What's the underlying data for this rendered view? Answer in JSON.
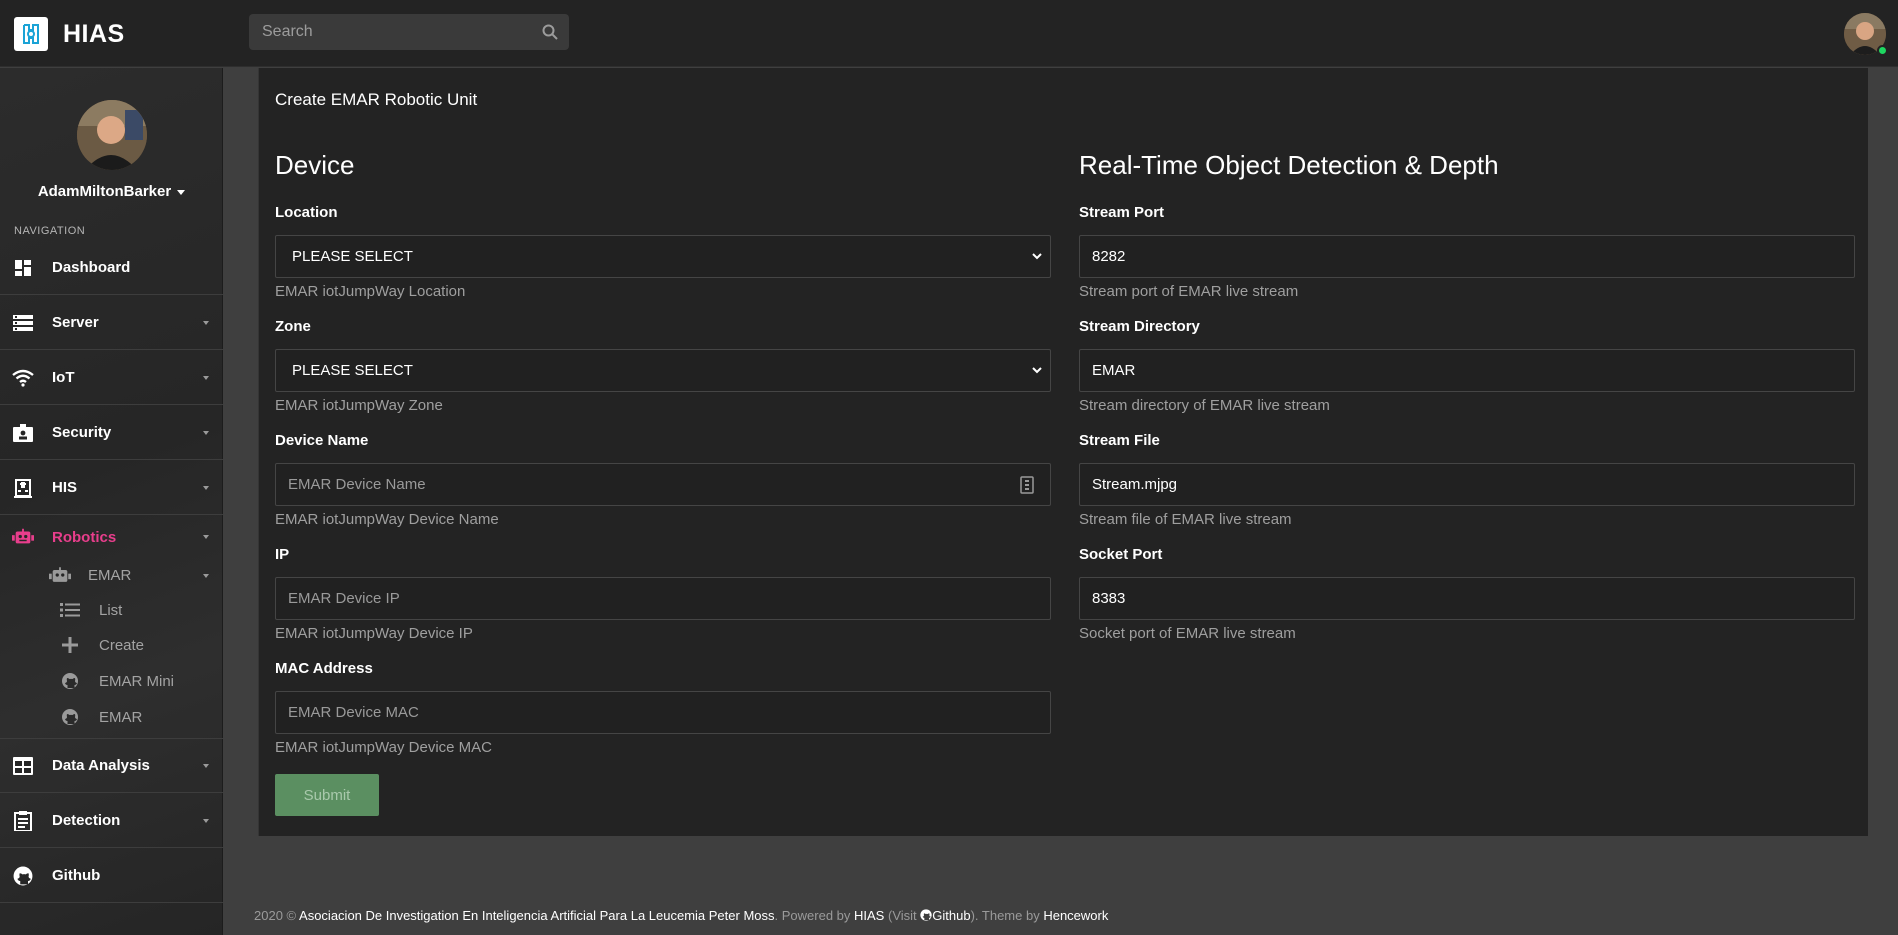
{
  "brand": {
    "name": "HIAS"
  },
  "search": {
    "placeholder": "Search"
  },
  "sidebar": {
    "username": "AdamMiltonBarker",
    "nav_heading": "NAVIGATION",
    "items": [
      {
        "label": "Dashboard",
        "icon": "dashboard-icon"
      },
      {
        "label": "Server",
        "icon": "server-icon"
      },
      {
        "label": "IoT",
        "icon": "wifi-icon"
      },
      {
        "label": "Security",
        "icon": "badge-icon"
      },
      {
        "label": "HIS",
        "icon": "hospital-icon"
      },
      {
        "label": "Robotics",
        "icon": "robot-icon"
      },
      {
        "label": "Data Analysis",
        "icon": "table-icon"
      },
      {
        "label": "Detection",
        "icon": "clipboard-icon"
      },
      {
        "label": "Github",
        "icon": "github-icon"
      }
    ],
    "robotics_sub": {
      "parent": {
        "label": "EMAR",
        "icon": "robot-icon"
      },
      "children": [
        {
          "label": "List",
          "icon": "list-icon"
        },
        {
          "label": "Create",
          "icon": "plus-icon"
        },
        {
          "label": "EMAR Mini",
          "icon": "github-icon"
        },
        {
          "label": "EMAR",
          "icon": "github-icon"
        }
      ]
    },
    "active_color": "#e83e8c"
  },
  "card": {
    "title": "Create EMAR Robotic Unit",
    "left": {
      "section": "Device",
      "location": {
        "label": "Location",
        "value": "PLEASE SELECT",
        "help": "EMAR iotJumpWay Location"
      },
      "zone": {
        "label": "Zone",
        "value": "PLEASE SELECT",
        "help": "EMAR iotJumpWay Zone"
      },
      "device_name": {
        "label": "Device Name",
        "placeholder": "EMAR Device Name",
        "help": "EMAR iotJumpWay Device Name"
      },
      "ip": {
        "label": "IP",
        "placeholder": "EMAR Device IP",
        "help": "EMAR iotJumpWay Device IP"
      },
      "mac": {
        "label": "MAC Address",
        "placeholder": "EMAR Device MAC",
        "help": "EMAR iotJumpWay Device MAC"
      }
    },
    "right": {
      "section": "Real-Time Object Detection & Depth",
      "stream_port": {
        "label": "Stream Port",
        "value": "8282",
        "help": "Stream port of EMAR live stream"
      },
      "stream_dir": {
        "label": "Stream Directory",
        "value": "EMAR",
        "help": "Stream directory of EMAR live stream"
      },
      "stream_file": {
        "label": "Stream File",
        "value": "Stream.mjpg",
        "help": "Stream file of EMAR live stream"
      },
      "socket_port": {
        "label": "Socket Port",
        "value": "8383",
        "help": "Socket port of EMAR live stream"
      }
    },
    "submit_label": "Submit",
    "submit_color": "#5b8f61"
  },
  "footer": {
    "prefix": "2020 ©",
    "org": "Asociacion De Investigation En Inteligencia Artificial Para La Leucemia Peter Moss",
    "powered": ". Powered by",
    "hias": "HIAS",
    "visit": "(Visit",
    "github": "Github",
    "theme": "). Theme by",
    "theme_author": "Hencework"
  }
}
